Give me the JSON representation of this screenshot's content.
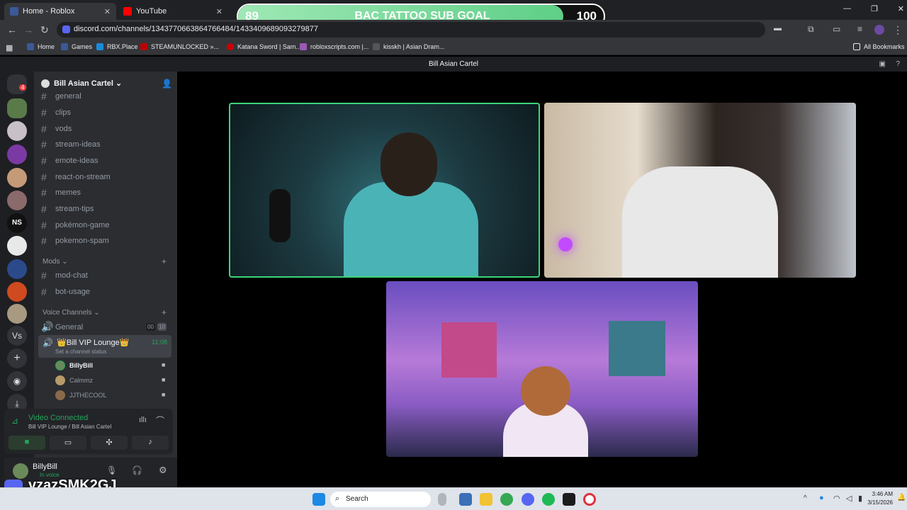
{
  "browser": {
    "tabs": [
      {
        "label": "Home - Roblox",
        "color": "#3b5998"
      },
      {
        "label": "YouTube",
        "color": "#ff0000"
      }
    ],
    "url": "discord.com/channels/1343770663864766484/1433409689093279877",
    "bookmarks": [
      "Home",
      "Games",
      "RBX.Place",
      "STEAMUNLOCKED »...",
      "Katana Sword | Sam...",
      "robloxscripts.com |...",
      "kisskh | Asian Dram..."
    ],
    "all_bookmarks": "All Bookmarks"
  },
  "goal": {
    "current": "89",
    "title": "BAC TATTOO SUB GOAL",
    "target": "100",
    "progress": 0.89
  },
  "discord": {
    "window_title": "Bill Asian Cartel",
    "server_name": "Bill Asian Cartel",
    "channels": [
      "general",
      "clips",
      "vods",
      "stream-ideas",
      "emote-ideas",
      "react-on-stream",
      "memes",
      "stream-tips",
      "pokémon-game",
      "pokemon-spam"
    ],
    "mods_category": "Mods",
    "mod_channels": [
      "mod-chat",
      "bot-usage"
    ],
    "voice_category": "Voice Channels",
    "voice_channels": [
      {
        "name": "General",
        "count": "00",
        "limit": "10"
      },
      {
        "name": "Bill VIP Lounge",
        "time": "11:08",
        "status": "Set a channel status"
      }
    ],
    "voice_users": [
      "BillyBill",
      "Calmmz",
      "JJTHECOOL"
    ],
    "rtc": {
      "status": "Video Connected",
      "location": "Bill VIP Lounge / Bill Asian Cartel"
    },
    "user": {
      "name": "BillyBill",
      "status": "In voice"
    },
    "guild_badge": "4",
    "guild_labels": [
      "NS",
      "Vs"
    ]
  },
  "overlay": {
    "watermark": "vzazSMK2GJ"
  },
  "taskbar": {
    "search": "Search",
    "time": "3:46 AM",
    "date": "3/15/2026"
  }
}
